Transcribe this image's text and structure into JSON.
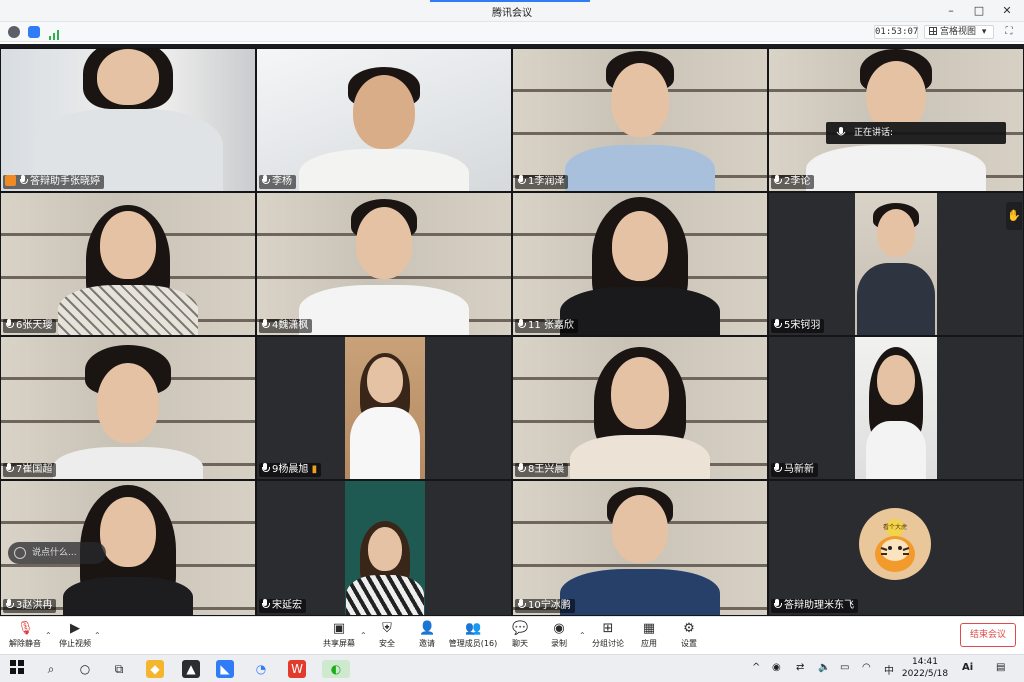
{
  "window": {
    "title": "腾讯会议",
    "minimize": "–",
    "maximize": "□",
    "close": "✕"
  },
  "toolbar": {
    "timer": "01:53:07",
    "view_label": "宫格视图",
    "view_caret": "▾",
    "fullscreen": "⛶"
  },
  "participants": [
    {
      "name": "答辩助手张晓婷",
      "host": true
    },
    {
      "name": "李杨"
    },
    {
      "name": "1李润泽"
    },
    {
      "name": "2李论"
    },
    {
      "name": "6张天璎"
    },
    {
      "name": "4魏潇枫"
    },
    {
      "name": "11 张嘉欣"
    },
    {
      "name": "5宋钶羽"
    },
    {
      "name": "7崔国超"
    },
    {
      "name": "9杨晨旭"
    },
    {
      "name": "8王兴晨"
    },
    {
      "name": "马新新"
    },
    {
      "name": "3赵洪冉"
    },
    {
      "name": "宋延宏"
    },
    {
      "name": "10宁冰鹏"
    },
    {
      "name": "答辩助理米东飞"
    }
  ],
  "speaking_label": "正在讲话:",
  "chat_placeholder": "说点什么...",
  "avatar_text": "看个大虎",
  "controls": {
    "mute": "解除静音",
    "video": "停止视频",
    "share": "共享屏幕",
    "security": "安全",
    "invite": "邀请",
    "members": "管理成员(16)",
    "chat": "聊天",
    "record": "录制",
    "breakout": "分组讨论",
    "apps": "应用",
    "settings": "设置",
    "end": "结束会议"
  },
  "taskbar": {
    "time": "14:41",
    "date": "2022/5/18",
    "ime": "中",
    "ai_label": "Ai"
  }
}
